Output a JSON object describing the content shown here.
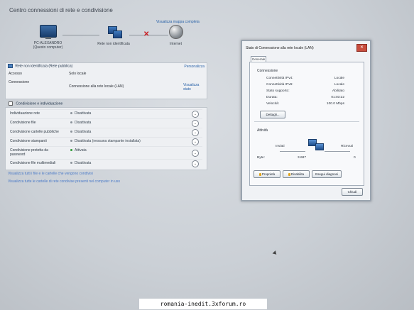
{
  "window": {
    "title": "Centro connessioni di rete e condivisione",
    "full_map_link": "Visualizza mappa completa"
  },
  "network_map": {
    "computer_name": "PC-ALEXANDRO",
    "computer_subtitle": "(Questo computer)",
    "network_label": "Rete non identificata",
    "internet_label": "Internet"
  },
  "network_panel": {
    "title": "Rete non identificata (Rete pubblica)",
    "customize_label": "Personalizza",
    "rows": [
      {
        "label": "Accesso",
        "value": "Solo locale"
      },
      {
        "label": "Connessione",
        "value": "Connessione alla rete locale (LAN)",
        "action": "Visualizza stato"
      }
    ]
  },
  "sharing_panel": {
    "title": "Condivisione e individuazione",
    "rows": [
      {
        "label": "Individuazione rete",
        "value": "Disattivata"
      },
      {
        "label": "Condivisione file",
        "value": "Disattivata"
      },
      {
        "label": "Condivisione cartelle pubbliche",
        "value": "Disattivata"
      },
      {
        "label": "Condivisione stampanti",
        "value": "Disattivata (nessuna stampante installata)"
      },
      {
        "label": "Condivisione protetta da password",
        "value": "Attivata"
      },
      {
        "label": "Condivisione file multimediali",
        "value": "Disattivata"
      }
    ]
  },
  "bottom_links": [
    "Visualizza tutti i file e le cartelle che vengono condivisi",
    "Visualizza tutte le cartelle di rete condivise presenti nel computer in uso"
  ],
  "dialog": {
    "title": "Stato di Connessione alla rete locale (LAN)",
    "close": "✕",
    "tab": "Generale",
    "connection_group": "Connessione",
    "fields": [
      {
        "label": "Connettività IPv4:",
        "value": "Locale"
      },
      {
        "label": "Connettività IPv6:",
        "value": "Locale"
      },
      {
        "label": "Stato supporto:",
        "value": "Abilitato"
      },
      {
        "label": "Durata:",
        "value": "01:03:22"
      },
      {
        "label": "Velocità:",
        "value": "100.0 Mbps"
      }
    ],
    "details_button": "Dettagli...",
    "activity_group": "Attività",
    "sent_label": "Inviati",
    "received_label": "Ricevuti",
    "bytes_label": "Byte:",
    "bytes_sent": "3.687",
    "bytes_received": "0",
    "buttons": [
      "Proprietà",
      "Disabilita",
      "Esegui diagnosi"
    ],
    "close_button": "Chiudi"
  },
  "watermark": "romania-inedit.3xforum.ro"
}
